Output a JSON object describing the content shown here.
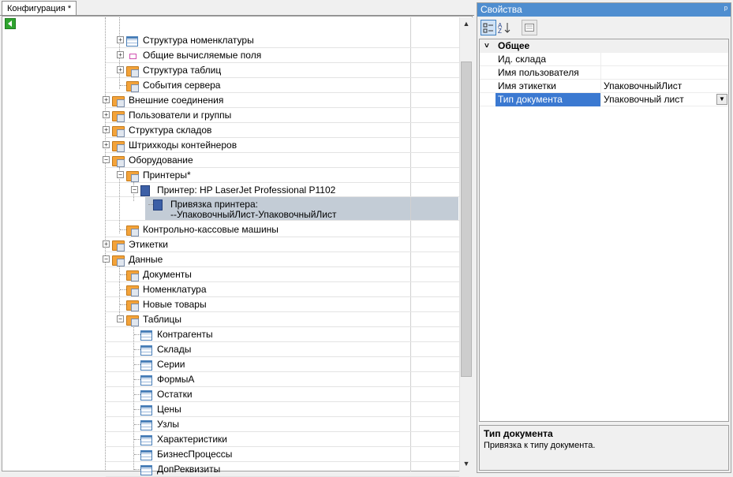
{
  "document_tab": "Конфигурация *",
  "tree": [
    {
      "label": "Структура номенклатуры",
      "icon": "table-icon"
    },
    {
      "label": "Общие вычисляемые поля",
      "icon": "field-icon"
    },
    {
      "label": "Структура таблиц",
      "icon": "folder-table-icon"
    },
    {
      "label": "События сервера",
      "icon": "folder-event-icon"
    },
    {
      "label": "Внешние соединения",
      "icon": "folder-connection-icon"
    },
    {
      "label": "Пользователи и группы",
      "icon": "folder-users-icon"
    },
    {
      "label": "Структура складов",
      "icon": "folder-warehouse-icon"
    },
    {
      "label": "Штрихкоды контейнеров",
      "icon": "folder-barcode-icon"
    },
    {
      "label": "Оборудование",
      "icon": "folder-equipment-icon"
    },
    {
      "label": "Принтеры*",
      "icon": "folder-printer-icon"
    },
    {
      "label": "Принтер: HP LaserJet Professional P1102",
      "icon": "printer-icon"
    },
    {
      "label": "Привязка принтера:",
      "label2": "--УпаковочныйЛист-УпаковочныйЛист",
      "icon": "printer-binding-icon"
    },
    {
      "label": "Контрольно-кассовые машины",
      "icon": "folder-cash-register-icon"
    },
    {
      "label": "Этикетки",
      "icon": "folder-label-icon"
    },
    {
      "label": "Данные",
      "icon": "folder-data-icon"
    },
    {
      "label": "Документы",
      "icon": "folder-doc-icon"
    },
    {
      "label": "Номенклатура",
      "icon": "folder-doc-icon"
    },
    {
      "label": "Новые товары",
      "icon": "folder-doc-icon"
    },
    {
      "label": "Таблицы",
      "icon": "folder-table-icon"
    },
    {
      "label": "Контрагенты",
      "icon": "table-icon"
    },
    {
      "label": "Склады",
      "icon": "table-icon"
    },
    {
      "label": "Серии",
      "icon": "table-icon"
    },
    {
      "label": "ФормыА",
      "icon": "table-icon"
    },
    {
      "label": "Остатки",
      "icon": "table-icon"
    },
    {
      "label": "Цены",
      "icon": "table-icon"
    },
    {
      "label": "Узлы",
      "icon": "table-icon"
    },
    {
      "label": "Характеристики",
      "icon": "table-icon"
    },
    {
      "label": "БизнесПроцессы",
      "icon": "table-icon"
    },
    {
      "label": "ДопРеквизиты",
      "icon": "table-icon"
    }
  ],
  "properties": {
    "title": "Свойства",
    "category": "Общее",
    "rows": [
      {
        "name": "Ид. склада",
        "value": ""
      },
      {
        "name": "Имя пользователя",
        "value": ""
      },
      {
        "name": "Имя этикетки",
        "value": "УпаковочныйЛист"
      },
      {
        "name": "Тип документа",
        "value": "Упаковочный лист"
      }
    ],
    "description_title": "Тип документа",
    "description_text": "Привязка к типу документа."
  },
  "colors": {
    "selection": "#c3ccd6",
    "panel_title": "#4f8ed0",
    "prop_selected": "#3b79d1"
  }
}
